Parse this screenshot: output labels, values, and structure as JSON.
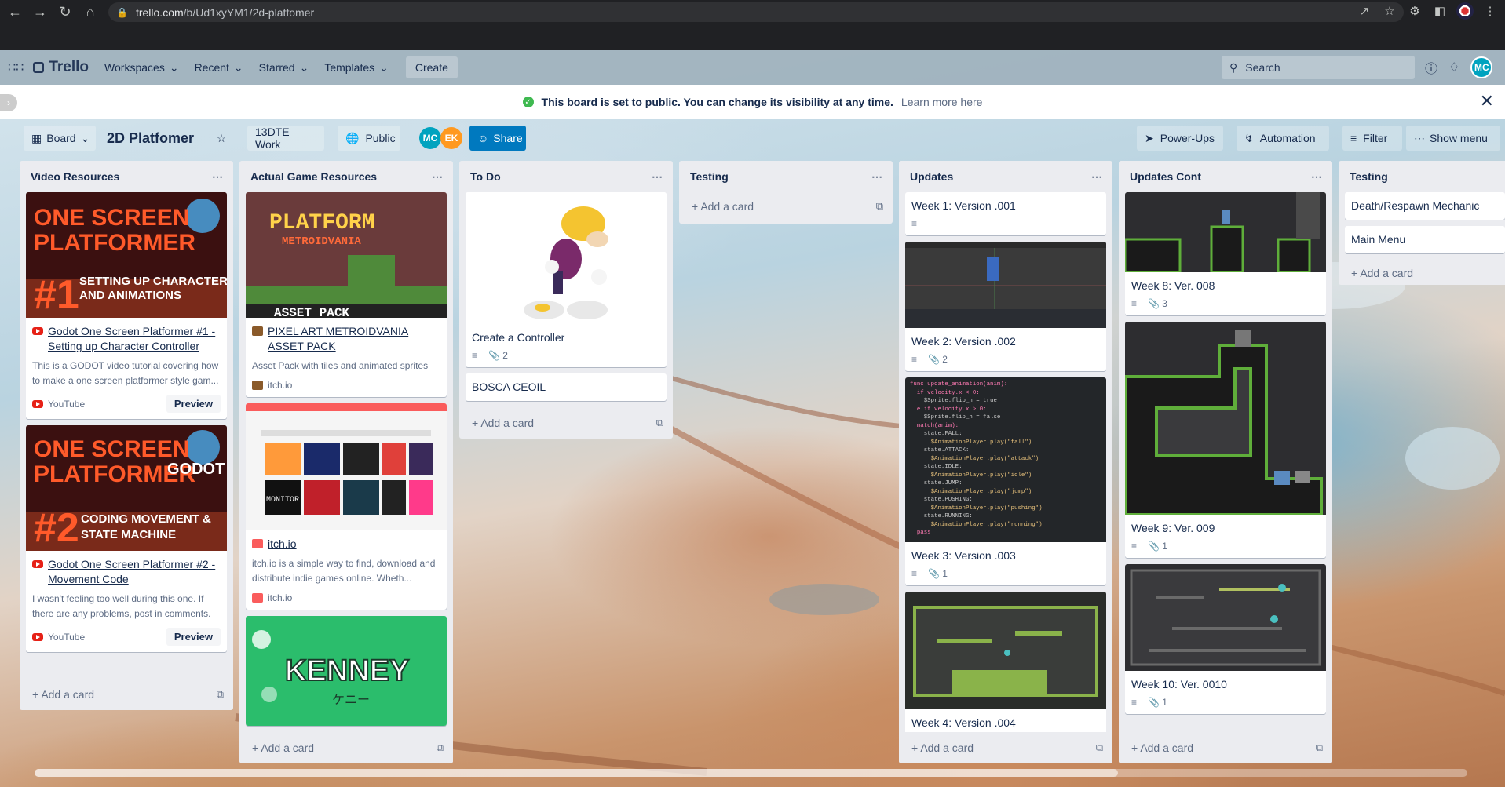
{
  "browser": {
    "url_domain": "trello.com",
    "url_path": "/b/Ud1xyYM1/2d-platfomer"
  },
  "appbar": {
    "logo": "Trello",
    "menus": [
      "Workspaces",
      "Recent",
      "Starred",
      "Templates"
    ],
    "create": "Create",
    "search_placeholder": "Search",
    "avatar": "MC"
  },
  "banner": {
    "message": "This board is set to public. You can change its visibility at any time.",
    "learn_more": "Learn more here"
  },
  "boardbar": {
    "view": "Board",
    "title": "2D Platfomer",
    "workspace": "13DTE Work",
    "visibility": "Public",
    "members": [
      "MC",
      "EK"
    ],
    "share": "Share",
    "power_ups": "Power-Ups",
    "automation": "Automation",
    "filter": "Filter",
    "show_menu": "Show menu"
  },
  "colors": {
    "share": "#0079bf",
    "member_mc": "#00a3bf",
    "member_ek": "#ff991f",
    "list_bg": "#ebecf0"
  },
  "lists": [
    {
      "title": "Video Resources",
      "add": "Add a card",
      "cards": [
        {
          "thumb_text": [
            "ONE SCREEN",
            "PLATFORMER",
            "#1",
            "SETTING UP CHARACTER",
            "AND ANIMATIONS"
          ],
          "title": "Godot One Screen Platformer #1 - Setting up Character Controller",
          "desc": "This is a GODOT video tutorial covering how to make a one screen platformer style gam...",
          "source": "YouTube",
          "preview": "Preview"
        },
        {
          "thumb_text": [
            "ONE SCREEN",
            "PLATFORMER",
            "#2",
            "CODING MOVEMENT &",
            "STATE MACHINE",
            "GODOT"
          ],
          "title": "Godot One Screen Platformer #2 - Movement Code",
          "desc": "I wasn't feeling too well during this one. If there are any problems, post in comments.",
          "source": "YouTube",
          "preview": "Preview"
        }
      ]
    },
    {
      "title": "Actual Game Resources",
      "add": "Add a card",
      "cards": [
        {
          "thumb_text": [
            "PLATFORM",
            "METROIDVANIA",
            "ASSET PACK"
          ],
          "title": "PIXEL ART METROIDVANIA ASSET PACK",
          "desc": "Asset Pack with tiles and animated sprites",
          "source": "itch.io"
        },
        {
          "thumb_text": [
            "MONITOR"
          ],
          "title": "itch.io",
          "desc": "itch.io is a simple way to find, download and distribute indie games online. Wheth...",
          "source": "itch.io"
        },
        {
          "thumb_text": [
            "KENNEY",
            "ケニー"
          ]
        }
      ]
    },
    {
      "title": "To Do",
      "add": "Add a card",
      "cards": [
        {
          "title": "Create a Controller",
          "attachments": "2"
        },
        {
          "title": "BOSCA CEOIL"
        }
      ]
    },
    {
      "title": "Testing",
      "add": "Add a card",
      "cards": []
    },
    {
      "title": "Updates",
      "add": "Add a card",
      "cards": [
        {
          "title": "Week 1: Version .001"
        },
        {
          "title": "Week 2: Version .002",
          "attachments": "2"
        },
        {
          "title": "Week 3: Version .003",
          "attachments": "1",
          "code": [
            "func update_animation(anim):",
            "  if velocity.x < 0:",
            "    $Sprite.flip_h = true",
            "  elif velocity.x > 0:",
            "    $Sprite.flip_h = false",
            "  match(anim):",
            "    state.FALL:",
            "      $AnimationPlayer.play(\"fall\")",
            "    state.ATTACK:",
            "      $AnimationPlayer.play(\"attack\")",
            "    state.IDLE:",
            "      $AnimationPlayer.play(\"idle\")",
            "    state.JUMP:",
            "      $AnimationPlayer.play(\"jump\")",
            "    state.PUSHING:",
            "      $AnimationPlayer.play(\"pushing\")",
            "    state.RUNNING:",
            "      $AnimationPlayer.play(\"running\")",
            "  pass"
          ]
        },
        {
          "title": "Week 4: Version .004"
        }
      ]
    },
    {
      "title": "Updates Cont",
      "add": "Add a card",
      "cards": [
        {
          "title": "Week 8: Ver. 008",
          "attachments": "3"
        },
        {
          "title": "Week 9: Ver. 009",
          "attachments": "1"
        },
        {
          "title": "Week 10: Ver. 0010",
          "attachments": "1"
        }
      ]
    },
    {
      "title": "Testing",
      "add": "Add a card",
      "cards": [
        {
          "title": "Death/Respawn Mechanic"
        },
        {
          "title": "Main Menu"
        }
      ]
    }
  ]
}
